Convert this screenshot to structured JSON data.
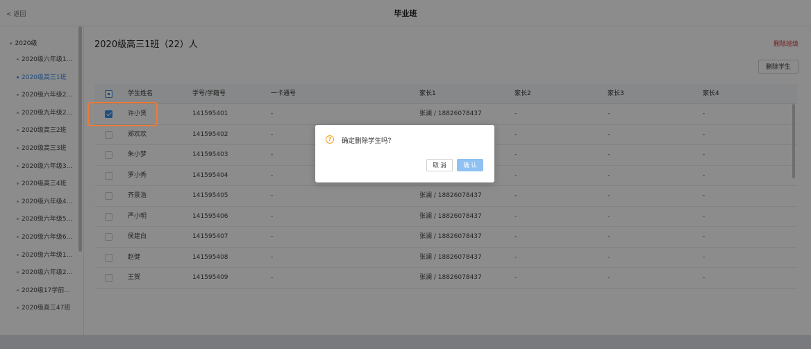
{
  "header": {
    "back_label": "< 返回",
    "title": "毕业班"
  },
  "sidebar": {
    "root_label": "2020级",
    "items": [
      {
        "label": "2020级六年级1...",
        "active": false
      },
      {
        "label": "2020级高三1班",
        "active": true
      },
      {
        "label": "2020级六年级2...",
        "active": false
      },
      {
        "label": "2020级九年级2...",
        "active": false
      },
      {
        "label": "2020级高三2班",
        "active": false
      },
      {
        "label": "2020级高三3班",
        "active": false
      },
      {
        "label": "2020级六年级3...",
        "active": false
      },
      {
        "label": "2020级高三4班",
        "active": false
      },
      {
        "label": "2020级六年级4...",
        "active": false
      },
      {
        "label": "2020级六年级5...",
        "active": false
      },
      {
        "label": "2020级六年级6...",
        "active": false
      },
      {
        "label": "2020级六年级1...",
        "active": false
      },
      {
        "label": "2020级六年级2...",
        "active": false
      },
      {
        "label": "2020级17学前...",
        "active": false
      },
      {
        "label": "2020级高三47班",
        "active": false
      }
    ]
  },
  "main": {
    "class_title": "2020级高三1班（22）人",
    "delete_class_label": "删除班级",
    "delete_student_label": "删除学生",
    "table": {
      "headers": {
        "name": "学生姓名",
        "student_id": "学号/学籍号",
        "card": "一卡通号",
        "parent1": "家长1",
        "parent2": "家长2",
        "parent3": "家长3",
        "parent4": "家长4"
      },
      "rows": [
        {
          "checked": true,
          "name": "许小贤",
          "student_id": "141595401",
          "card": "-",
          "parent1": "张澜 / 18826078437",
          "parent2": "-",
          "parent3": "-",
          "parent4": "-"
        },
        {
          "checked": false,
          "name": "郑欢欢",
          "student_id": "141595402",
          "card": "-",
          "parent1": "",
          "parent2": "-",
          "parent3": "-",
          "parent4": "-"
        },
        {
          "checked": false,
          "name": "朱小梦",
          "student_id": "141595403",
          "card": "-",
          "parent1": "",
          "parent2": "-",
          "parent3": "-",
          "parent4": "-"
        },
        {
          "checked": false,
          "name": "罗小秀",
          "student_id": "141595404",
          "card": "-",
          "parent1": "",
          "parent2": "-",
          "parent3": "-",
          "parent4": "-"
        },
        {
          "checked": false,
          "name": "齐景浩",
          "student_id": "141595405",
          "card": "-",
          "parent1": "张澜 / 18826078437",
          "parent2": "-",
          "parent3": "-",
          "parent4": "-"
        },
        {
          "checked": false,
          "name": "严小明",
          "student_id": "141595406",
          "card": "-",
          "parent1": "张澜 / 18826078437",
          "parent2": "-",
          "parent3": "-",
          "parent4": "-"
        },
        {
          "checked": false,
          "name": "侯建白",
          "student_id": "141595407",
          "card": "-",
          "parent1": "张澜 / 18826078437",
          "parent2": "-",
          "parent3": "-",
          "parent4": "-"
        },
        {
          "checked": false,
          "name": "赵健",
          "student_id": "141595408",
          "card": "-",
          "parent1": "张澜 / 18826078437",
          "parent2": "-",
          "parent3": "-",
          "parent4": "-"
        },
        {
          "checked": false,
          "name": "王贺",
          "student_id": "141595409",
          "card": "-",
          "parent1": "张澜 / 18826078437",
          "parent2": "-",
          "parent3": "-",
          "parent4": "-"
        }
      ]
    }
  },
  "dialog": {
    "icon": "question-icon",
    "message": "确定删除学生吗？",
    "cancel_label": "取 消",
    "confirm_label": "确 认"
  },
  "colors": {
    "accent": "#3b8ee8",
    "danger": "#d23a3a",
    "highlight": "#ec7a3a",
    "warning": "#f0a020"
  }
}
